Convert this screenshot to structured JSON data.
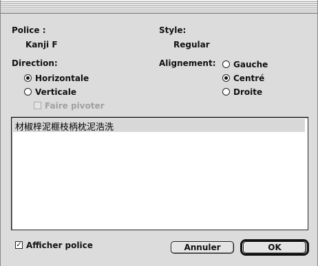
{
  "labels": {
    "font": "Police :",
    "font_value": "Kanji F",
    "style": "Style:",
    "style_value": "Regular",
    "direction": "Direction:",
    "alignment": "Alignement:"
  },
  "direction_options": [
    {
      "label": "Horizontale",
      "selected": true
    },
    {
      "label": "Verticale",
      "selected": false
    }
  ],
  "rotate_checkbox": {
    "label": "Faire pivoter",
    "checked": false,
    "enabled": false
  },
  "alignment_options": [
    {
      "label": "Gauche",
      "selected": false
    },
    {
      "label": "Centré",
      "selected": true
    },
    {
      "label": "Droite",
      "selected": false
    }
  ],
  "preview": {
    "text": "材椒梓泥榧枝柄枕泥浩洗"
  },
  "show_font_checkbox": {
    "label": "Afficher police",
    "checked": true
  },
  "buttons": {
    "cancel": "Annuler",
    "ok": "OK"
  }
}
